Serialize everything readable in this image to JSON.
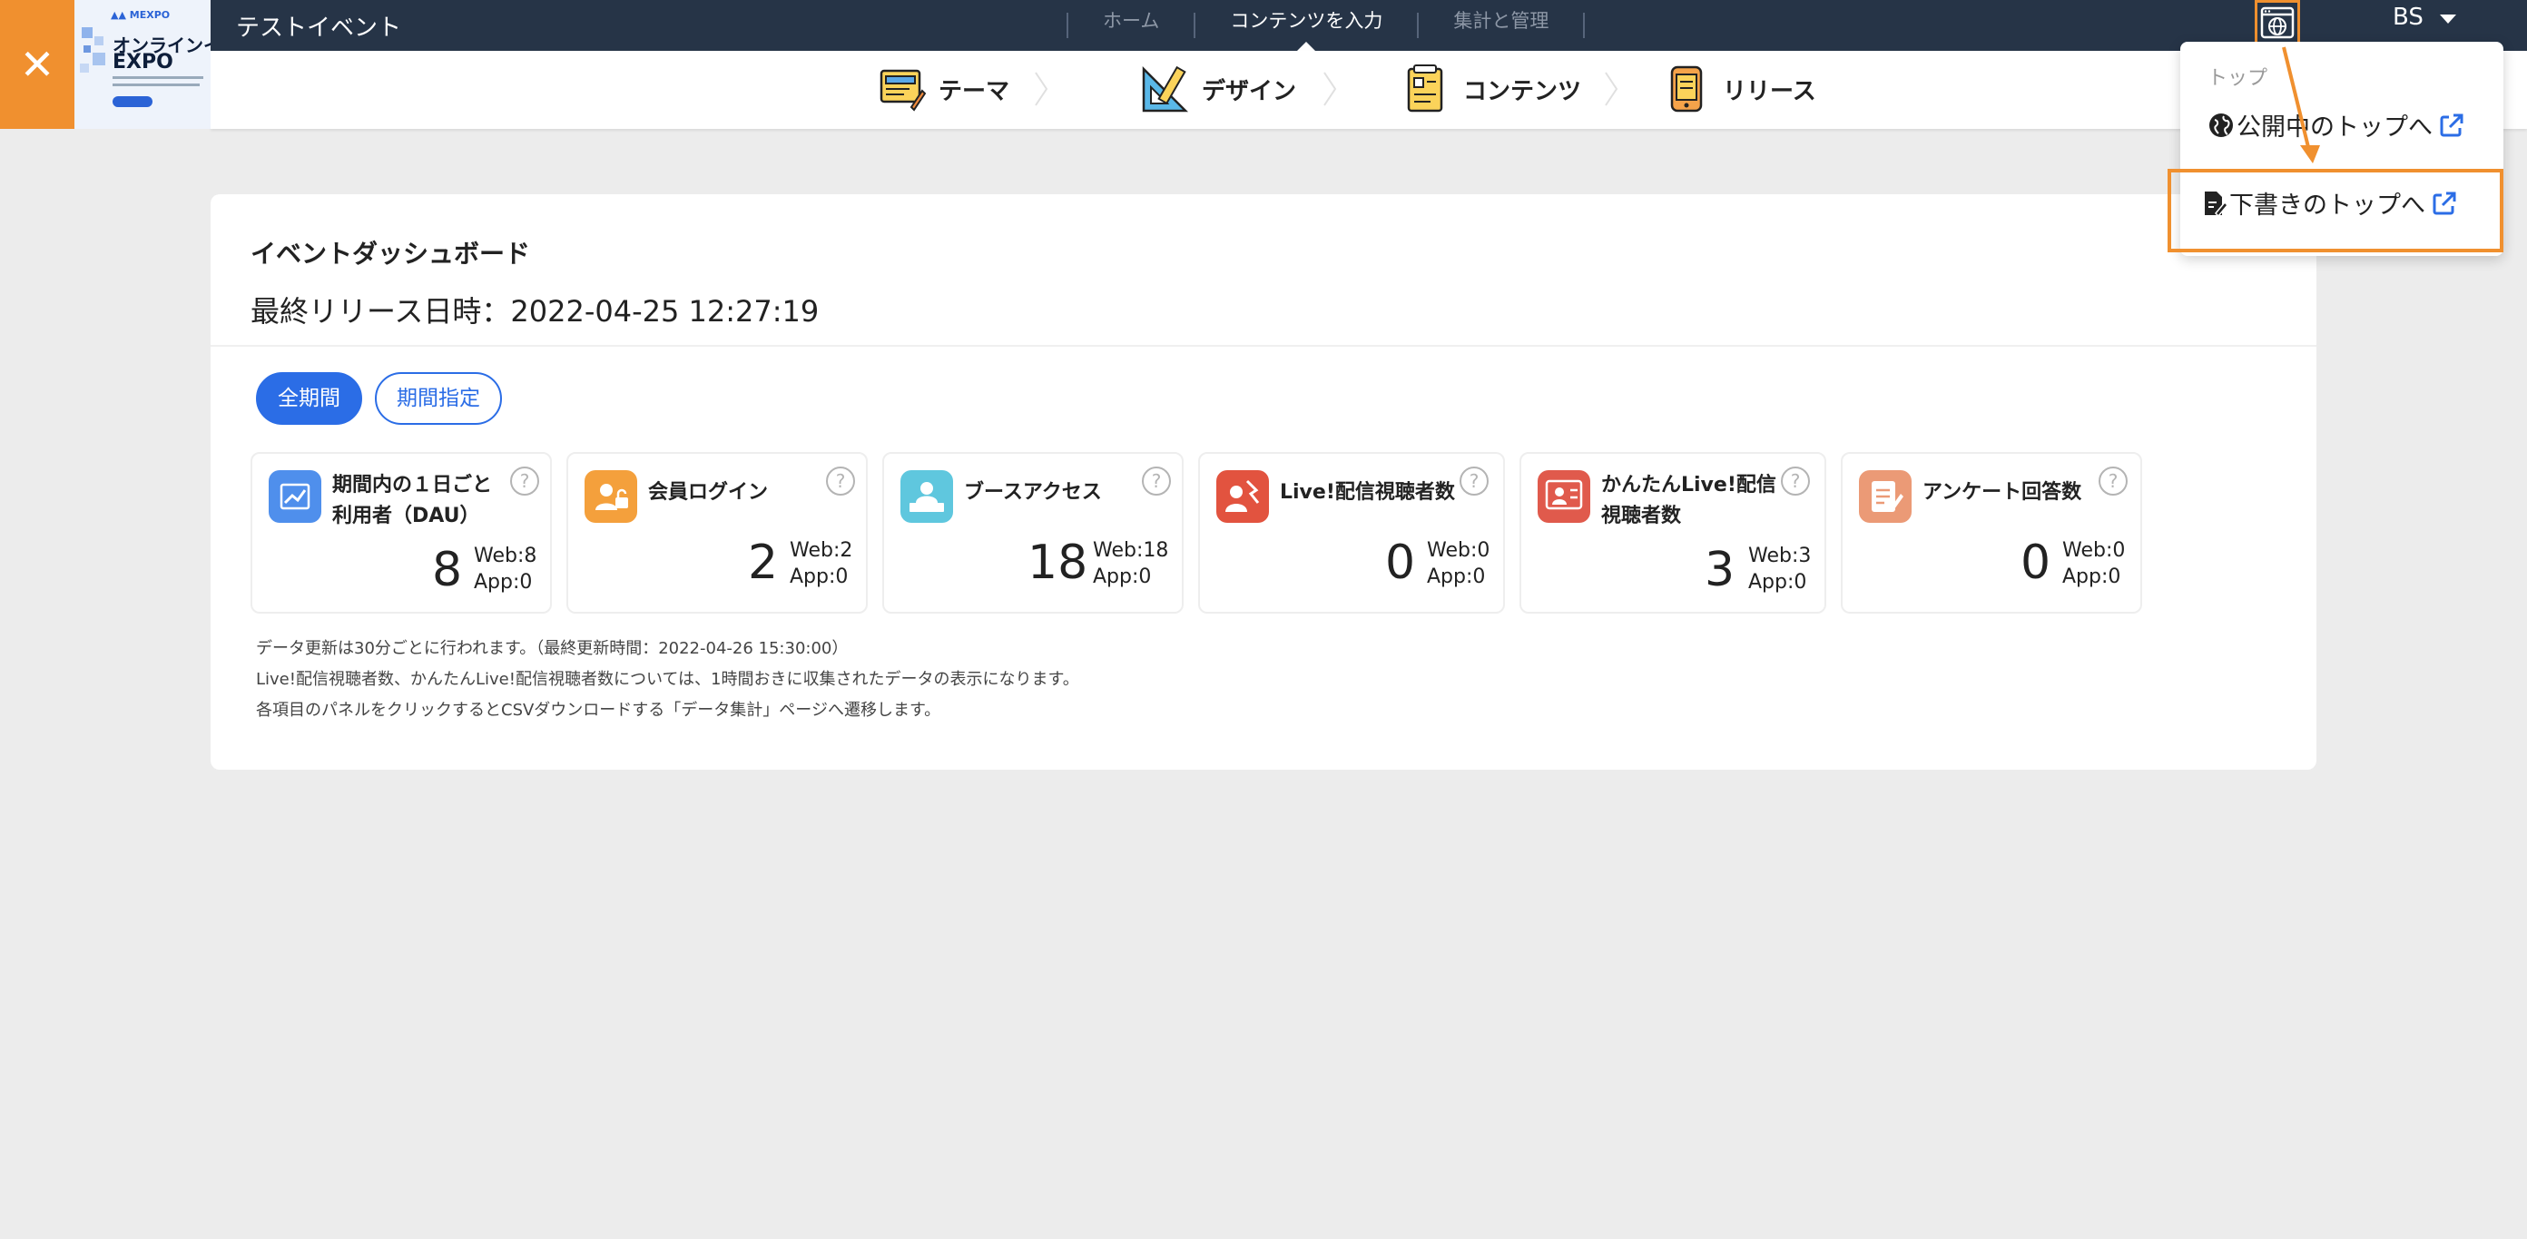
{
  "topbar": {
    "event_title": "テストイベント",
    "nav": [
      {
        "label": "ホーム"
      },
      {
        "label": "コンテンツを入力"
      },
      {
        "label": "集計と管理"
      }
    ],
    "user": "BS"
  },
  "thumbnail": {
    "line1": "オンラインイ",
    "line2": "EXPO"
  },
  "steps": [
    {
      "label": "テーマ"
    },
    {
      "label": "デザイン"
    },
    {
      "label": "コンテンツ"
    },
    {
      "label": "リリース"
    }
  ],
  "dashboard": {
    "title": "イベントダッシュボード",
    "release": "最終リリース日時：2022-04-25 12:27:19",
    "filters": {
      "all": "全期間",
      "range": "期間指定"
    },
    "metrics": [
      {
        "title_l1": "期間内の１日ごと",
        "title_l2": "利用者（DAU）",
        "value": "8",
        "web": "Web:8",
        "app": "App:0",
        "color": "#4f8fec"
      },
      {
        "title_l1": "会員ログイン",
        "title_l2": "",
        "value": "2",
        "web": "Web:2",
        "app": "App:0",
        "color": "#f4a03c"
      },
      {
        "title_l1": "ブースアクセス",
        "title_l2": "",
        "value": "18",
        "web": "Web:18",
        "app": "App:0",
        "color": "#5fc7de"
      },
      {
        "title_l1": "Live!配信視聴者数",
        "title_l2": "",
        "value": "0",
        "web": "Web:0",
        "app": "App:0",
        "color": "#e2533f"
      },
      {
        "title_l1": "かんたんLive!配信",
        "title_l2": "視聴者数",
        "value": "3",
        "web": "Web:3",
        "app": "App:0",
        "color": "#e05a4c"
      },
      {
        "title_l1": "アンケート回答数",
        "title_l2": "",
        "value": "0",
        "web": "Web:0",
        "app": "App:0",
        "color": "#eb9a76"
      }
    ],
    "notes": [
      "データ更新は30分ごとに行われます。（最終更新時間：2022-04-26 15:30:00）",
      "Live!配信視聴者数、かんたんLive!配信視聴者数については、1時間おきに収集されたデータの表示になります。",
      "各項目のパネルをクリックするとCSVダウンロードする「データ集計」ページへ遷移します。"
    ]
  },
  "dropdown": {
    "header": "トップ",
    "items": [
      {
        "label": "公開中のトップへ"
      },
      {
        "label": "下書きのトップへ"
      }
    ]
  },
  "colors": {
    "accent_orange": "#f0902f",
    "primary_blue": "#2b6de6",
    "topbar_navy": "#263447"
  }
}
